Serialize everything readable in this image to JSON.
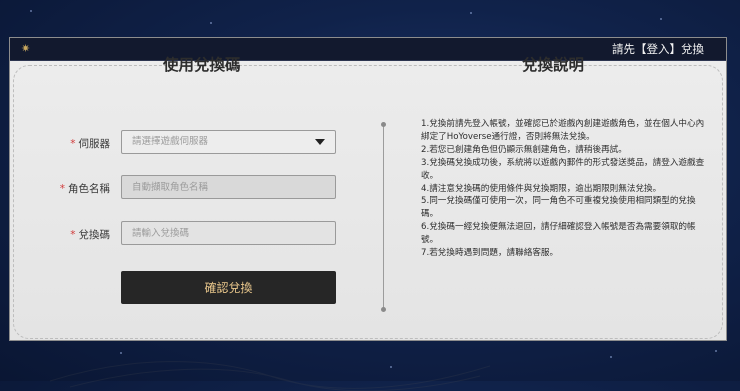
{
  "topbar": {
    "login_label": "請先【登入】兌換",
    "icon": "gear-icon"
  },
  "left": {
    "title": "使用兌換碼",
    "server": {
      "label": "伺服器",
      "placeholder": "請選擇遊戲伺服器"
    },
    "role": {
      "label": "角色名稱",
      "placeholder": "自動擷取角色名稱"
    },
    "code": {
      "label": "兌換碼",
      "placeholder": "請輸入兌換碼"
    },
    "submit_label": "確認兌換",
    "required_mark": "*"
  },
  "right": {
    "title": "兌換說明",
    "items": [
      "1.兌換前請先登入帳號，並確認已於遊戲內創建遊戲角色，並在個人中心內綁定了HoYoverse通行證，否則將無法兌換。",
      "2.若您已創建角色但仍顯示無創建角色，請稍後再試。",
      "3.兌換碼兌換成功後，系統將以遊戲內郵件的形式發送獎品，請登入遊戲查收。",
      "4.請注意兌換碼的使用條件與兌換期限，逾出期限則無法兌換。",
      "5.同一兌換碼僅可使用一次，同一角色不可重複兌換使用相同類型的兌換碼。",
      "6.兌換碼一經兌換便無法退回，請仔細確認登入帳號是否為需要領取的帳號。",
      "7.若兌換時遇到問題，請聯絡客服。"
    ]
  },
  "colors": {
    "accent": "#e9c78c",
    "button_bg": "#262626",
    "required": "#d13b3b"
  }
}
